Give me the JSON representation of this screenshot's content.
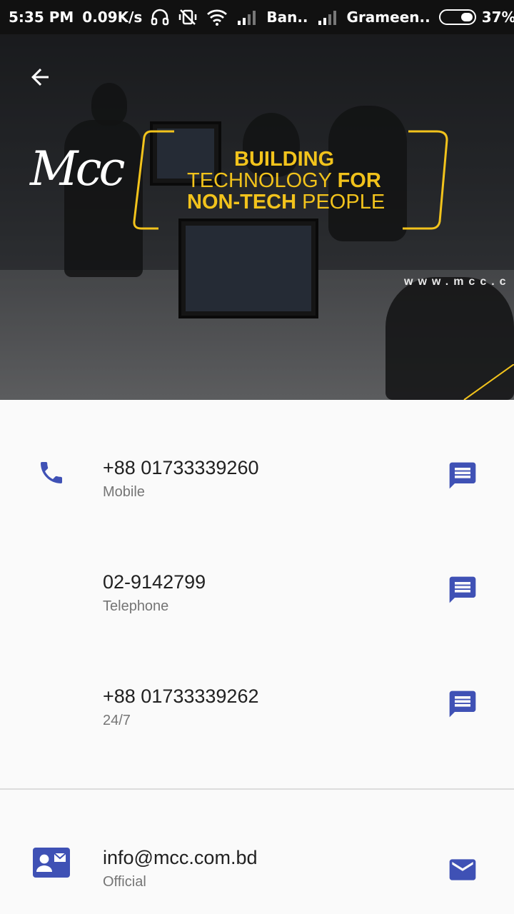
{
  "status_bar": {
    "time": "5:35 PM",
    "net_speed": "0.09K/s",
    "carrier1": "Ban..",
    "carrier2": "Grameen..",
    "battery": "37%",
    "battery_level": 0.37,
    "icons": [
      "headset-icon",
      "vibrate-off-icon",
      "wifi-icon",
      "signal-icon",
      "signal-icon",
      "battery-icon"
    ]
  },
  "header": {
    "back_icon": "arrow-back-icon",
    "logo_text": "Mcc",
    "tagline": {
      "line1": "BUILDING",
      "line2_a": "TECHNOLOGY",
      "line2_b": "FOR",
      "line3_a": "NON-TECH",
      "line3_b": "PEOPLE"
    },
    "website": "www.mcc.c",
    "accent_color": "#f2c31c"
  },
  "contacts": {
    "phones": [
      {
        "number": "+88 01733339260",
        "label": "Mobile",
        "action_icon": "message-icon"
      },
      {
        "number": "02-9142799",
        "label": "Telephone",
        "action_icon": "message-icon"
      },
      {
        "number": "+88 01733339262",
        "label": "24/7",
        "action_icon": "message-icon"
      }
    ],
    "phone_icon": "phone-icon",
    "email": {
      "address": "info@mcc.com.bd",
      "label": "Official",
      "lead_icon": "contact-mail-icon",
      "action_icon": "email-icon"
    },
    "icon_color": "#3f51b5"
  }
}
